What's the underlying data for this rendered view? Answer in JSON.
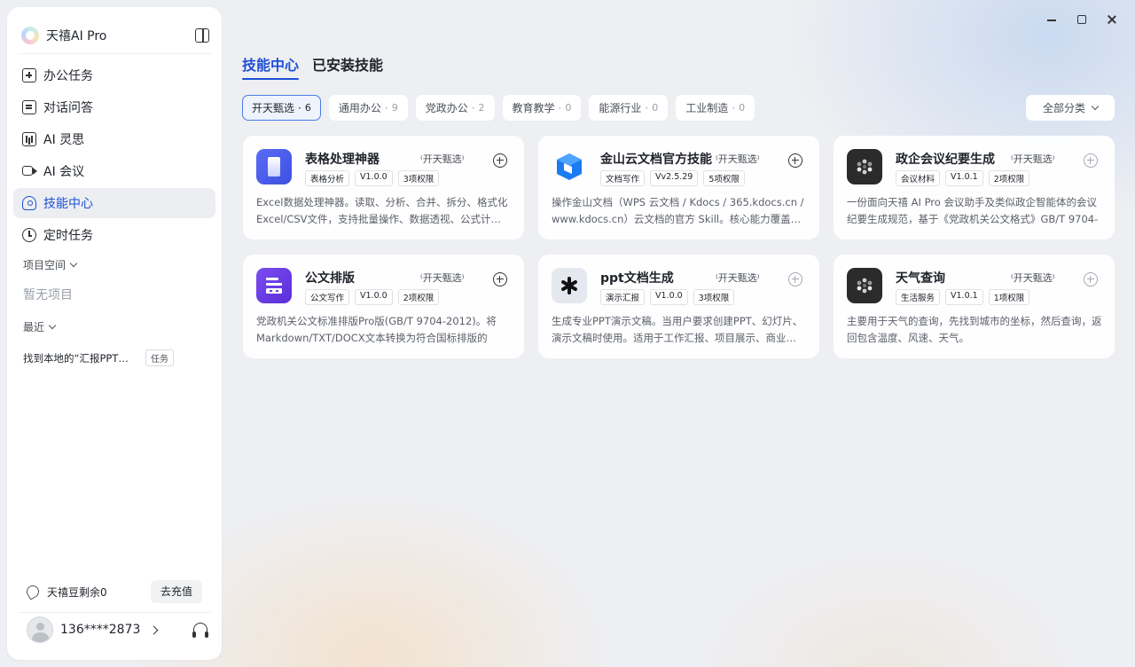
{
  "app": {
    "title": "天禧AI Pro"
  },
  "sidebar": {
    "items": [
      {
        "label": "办公任务",
        "icon": "new-task-icon"
      },
      {
        "label": "对话问答",
        "icon": "chat-icon"
      },
      {
        "label": "AI 灵思",
        "icon": "insight-icon"
      },
      {
        "label": "AI 会议",
        "icon": "meeting-camera-icon"
      },
      {
        "label": "技能中心",
        "icon": "skill-icon",
        "active": true
      },
      {
        "label": "定时任务",
        "icon": "clock-icon"
      }
    ],
    "project_space_label": "项目空间",
    "project_empty": "暂无项目",
    "recent_label": "最近",
    "recent_items": [
      {
        "text": "找到本地的“汇报PPT…",
        "badge": "任务"
      }
    ],
    "balance_text": "天禧豆剩余0",
    "recharge_label": "去充值",
    "user_phone": "136****2873"
  },
  "main": {
    "tabs": [
      {
        "label": "技能中心",
        "active": true
      },
      {
        "label": "已安装技能",
        "active": false
      }
    ],
    "filters": [
      {
        "label": "开天甄选",
        "count": "6",
        "active": true
      },
      {
        "label": "通用办公",
        "count": "9"
      },
      {
        "label": "党政办公",
        "count": "2"
      },
      {
        "label": "教育教学",
        "count": "0"
      },
      {
        "label": "能源行业",
        "count": "0"
      },
      {
        "label": "工业制造",
        "count": "0"
      }
    ],
    "filter_dot": "·",
    "category_select": "全部分类",
    "cards": [
      {
        "title": "表格处理神器",
        "badge": "⁽开天甄选⁾",
        "tags": [
          "表格分析",
          "V1.0.0",
          "3项权限"
        ],
        "desc": "Excel数据处理神器。读取、分析、合并、拆分、格式化Excel/CSV文件，支持批量操作、数据透视、公式计…",
        "icon": "spreadsheet-icon",
        "icon_color": "#4a5ae8",
        "add_muted": false
      },
      {
        "title": "金山云文档官方技能",
        "badge": "⁽开天甄选⁾",
        "tags": [
          "文档写作",
          "Vv2.5.29",
          "5项权限"
        ],
        "desc": "操作金山文档（WPS 云文档 / Kdocs / 365.kdocs.cn / www.kdocs.cn）云文档的官方 Skill。核心能力覆盖…",
        "icon": "kdocs-icon",
        "icon_color": "#1a7cf0",
        "add_muted": false
      },
      {
        "title": "政企会议纪要生成",
        "badge": "⁽开天甄选⁾",
        "tags": [
          "会议材料",
          "V1.0.1",
          "2项权限"
        ],
        "desc": "一份面向天禧 AI Pro 会议助手及类似政企智能体的会议纪要生成规范，基于《党政机关公文格式》GB/T 9704-20…",
        "icon": "meeting-minutes-icon",
        "icon_color": "#2b2b2b",
        "add_muted": true
      },
      {
        "title": "公文排版",
        "badge": "⁽开天甄选⁾",
        "tags": [
          "公文写作",
          "V1.0.0",
          "2项权限"
        ],
        "desc": "党政机关公文标准排版Pro版(GB/T 9704-2012)。将Markdown/TXT/DOCX文本转换为符合国标排版的Wor…",
        "icon": "document-format-icon",
        "icon_color": "#6a3de8",
        "add_muted": false
      },
      {
        "title": "ppt文档生成",
        "badge": "⁽开天甄选⁾",
        "tags": [
          "演示汇报",
          "V1.0.0",
          "3项权限"
        ],
        "desc": "生成专业PPT演示文稿。当用户要求创建PPT、幻灯片、演示文稿时使用。适用于工作汇报、项目展示、商业…",
        "icon": "ppt-generate-icon",
        "icon_color": "#e6e8f0",
        "add_muted": true
      },
      {
        "title": "天气查询",
        "badge": "⁽开天甄选⁾",
        "tags": [
          "生活服务",
          "V1.0.1",
          "1项权限"
        ],
        "desc": "主要用于天气的查询，先找到城市的坐标，然后查询，返回包含温度、风速、天气。",
        "icon": "weather-icon",
        "icon_color": "#2b2b2b",
        "add_muted": true
      }
    ]
  },
  "colors": {
    "accent": "#1f4fd6",
    "active_nav_bg": "#eceef2"
  }
}
